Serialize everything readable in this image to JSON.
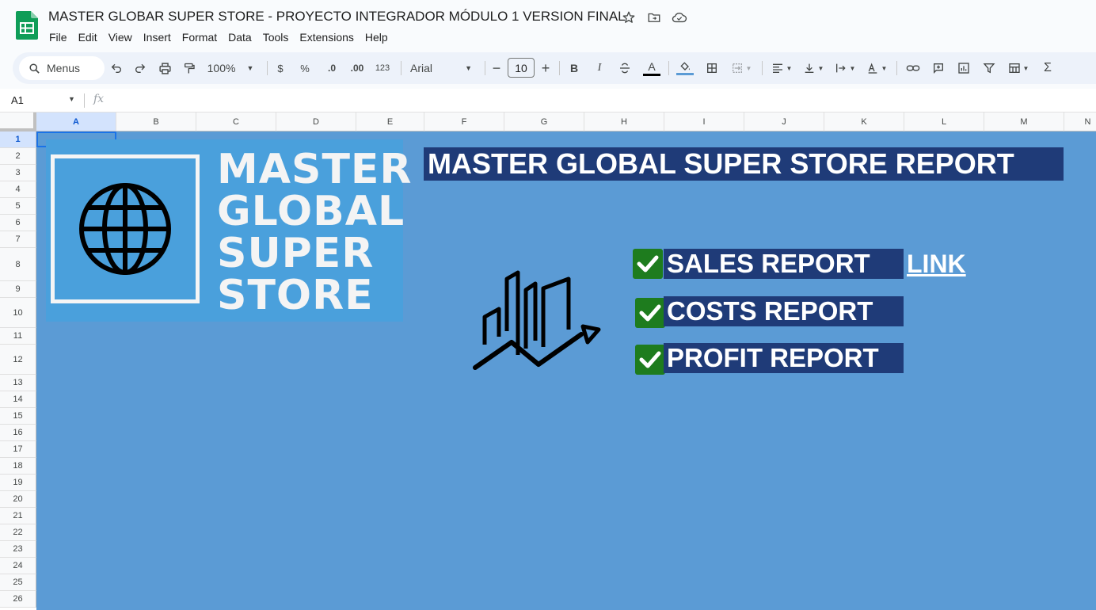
{
  "app": {
    "doc_title": "MASTER GLOBAR SUPER STORE - PROYECTO INTEGRADOR MÓDULO 1 VERSION FINAL",
    "icons": [
      "sheets-logo-icon",
      "star-icon",
      "move-to-folder-icon",
      "cloud-status-icon"
    ]
  },
  "menu": [
    "File",
    "Edit",
    "View",
    "Insert",
    "Format",
    "Data",
    "Tools",
    "Extensions",
    "Help"
  ],
  "toolbar": {
    "menus_label": "Menus",
    "zoom": "100%",
    "currency": "$",
    "percent": "%",
    "decrease_decimal": ".0",
    "increase_decimal": ".00",
    "number_format": "123",
    "font": "Arial",
    "font_size": "10",
    "bold": "B",
    "italic": "I",
    "text_color": "A",
    "sum": "Σ"
  },
  "formula_bar": {
    "cell_ref": "A1",
    "fx": "fx"
  },
  "columns": [
    "A",
    "B",
    "C",
    "D",
    "E",
    "F",
    "G",
    "H",
    "I",
    "J",
    "K",
    "L",
    "M",
    "N"
  ],
  "rows": [
    "1",
    "2",
    "3",
    "4",
    "5",
    "6",
    "7",
    "8",
    "9",
    "10",
    "11",
    "12",
    "13",
    "14",
    "15",
    "16",
    "17",
    "18",
    "19",
    "20",
    "21",
    "22",
    "23",
    "24",
    "25",
    "26"
  ],
  "sheet": {
    "logo_lines": [
      "MASTER",
      "GLOBAL",
      "SUPER",
      "STORE"
    ],
    "report_title": "MASTER GLOBAL SUPER STORE REPORT",
    "reports": [
      {
        "label": "SALES REPORT"
      },
      {
        "label": "COSTS REPORT"
      },
      {
        "label": "PROFIT REPORT"
      }
    ],
    "link_text": "LINK",
    "colors": {
      "background": "#5b9bd5",
      "title_bg": "#1f3b78",
      "logo_bg": "#4aa0dc",
      "check_bg": "#1e7c1e"
    }
  }
}
